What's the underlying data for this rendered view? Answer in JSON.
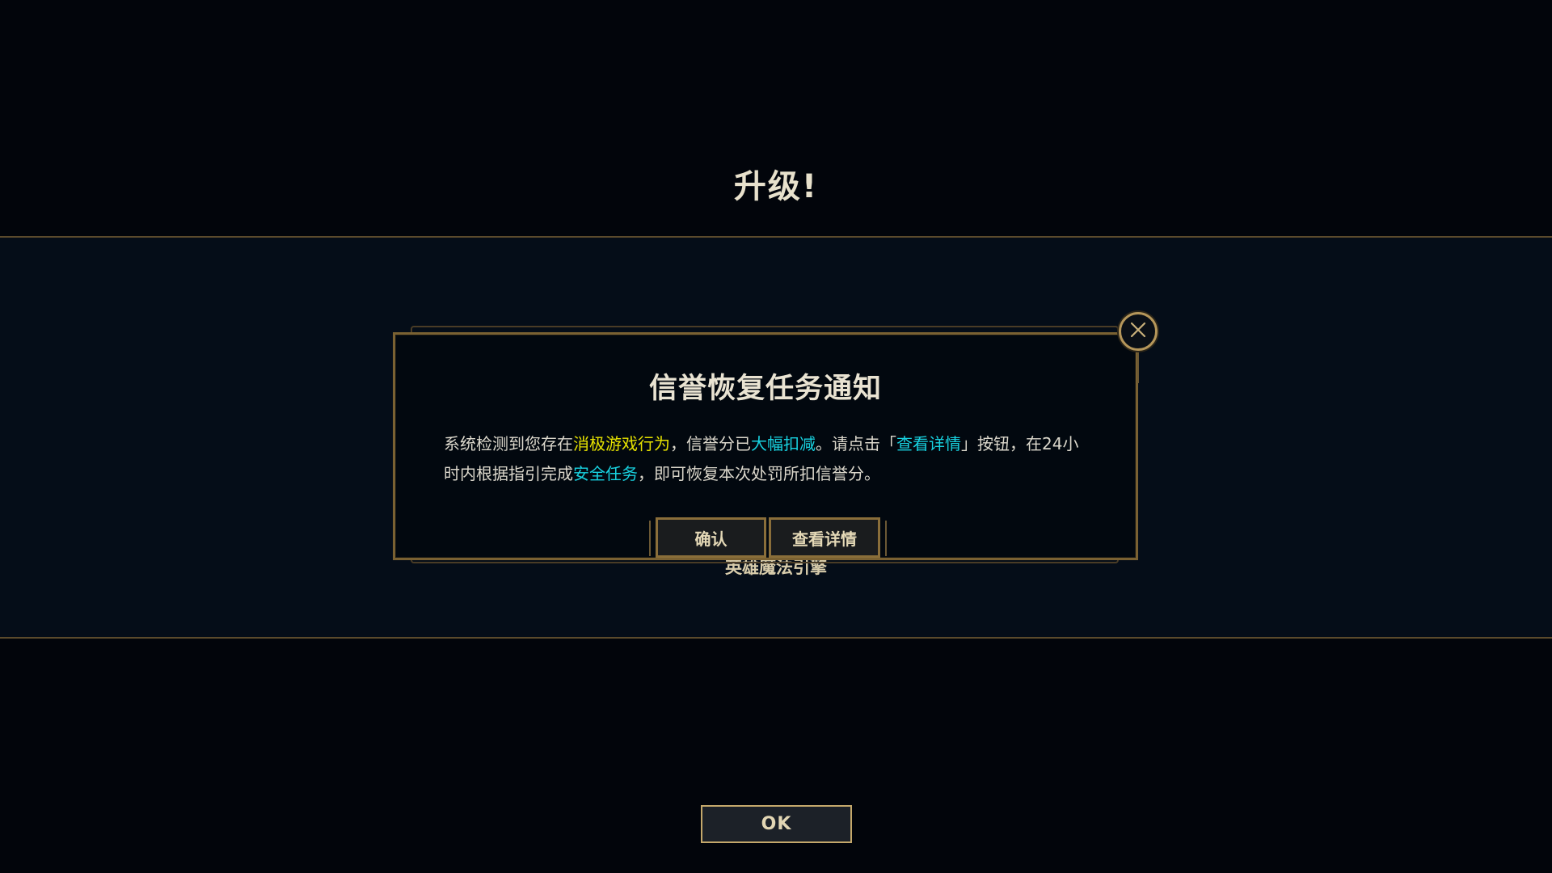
{
  "screen": {
    "title": "升级!",
    "under_label": "英雄魔法引擎",
    "ok_label": "OK"
  },
  "dialog": {
    "title": "信誉恢复任务通知",
    "body": {
      "p1": "系统检测到您存在",
      "hl1": "消极游戏行为",
      "p2": "，信誉分已",
      "hl2": "大幅扣减",
      "p3": "。请点击「",
      "hl3": "查看详情",
      "p4": "」按钮，在24小时内根据指引完成",
      "hl4": "安全任务",
      "p5": "，即可恢复本次处罚所扣信誉分。"
    },
    "confirm_label": "确认",
    "details_label": "查看详情",
    "close_icon": "close-icon"
  },
  "colors": {
    "gold_border": "#c4a86b",
    "highlight_yellow": "#e6e200",
    "highlight_cyan": "#18d2e0",
    "background": "#02060d"
  }
}
